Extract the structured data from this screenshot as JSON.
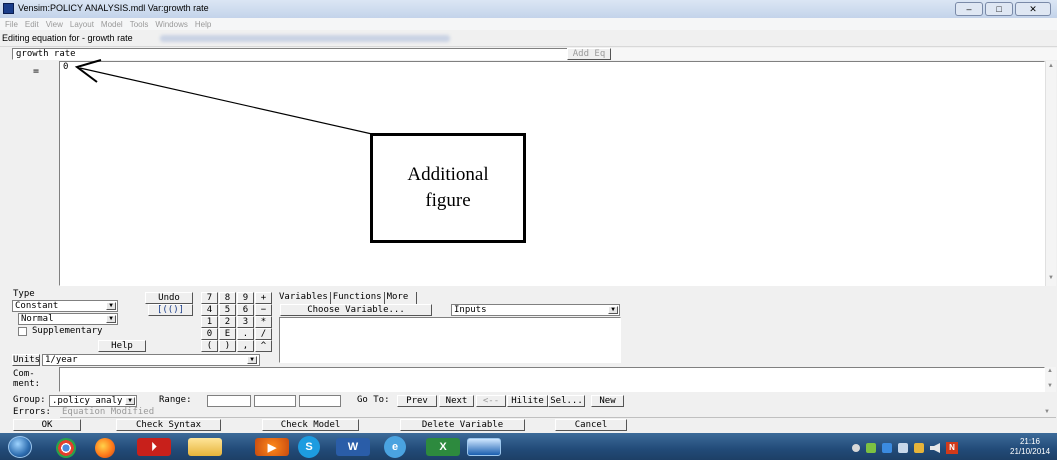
{
  "window": {
    "title": "Vensim:POLICY ANALYSIS.mdl Var:growth rate",
    "controls": {
      "minimize": "–",
      "maximize": "□",
      "close": "✕"
    }
  },
  "menu": [
    "File",
    "Edit",
    "View",
    "Layout",
    "Model",
    "Tools",
    "Windows",
    "Help"
  ],
  "editor": {
    "label": "Editing equation for - growth rate",
    "variable_name": "growth rate",
    "add_eq_label": "Add Eq",
    "eq_sign": "=",
    "equation": "0"
  },
  "annotation": {
    "line1": "Additional",
    "line2": "figure"
  },
  "type_panel": {
    "type_label": "Type",
    "type_value": "Constant",
    "subtype_value": "Normal",
    "supplementary_label": "Supplementary",
    "undo_label": "Undo",
    "paren_label": "[(()]",
    "help_label": "Help",
    "units_label": "Units",
    "units_value": "1/year"
  },
  "keypad": [
    [
      "7",
      "8",
      "9",
      "+"
    ],
    [
      "4",
      "5",
      "6",
      "−"
    ],
    [
      "1",
      "2",
      "3",
      "*"
    ],
    [
      "0",
      "E",
      ".",
      "/"
    ],
    [
      "(",
      ")",
      ",",
      "^"
    ]
  ],
  "var_panel": {
    "tabs": [
      "Variables",
      "Functions",
      "More"
    ],
    "choose_label": "Choose Variable...",
    "inputs_value": "Inputs"
  },
  "comment_label": "Com-\nment:",
  "group": {
    "label": "Group:",
    "value": ".policy analy",
    "range_label": "Range:",
    "goto_label": "Go To:",
    "buttons": [
      "Prev",
      "Next",
      "<--",
      "Hilite",
      "Sel...",
      "New"
    ]
  },
  "errors": {
    "label": "Errors:",
    "value": "Equation Modified"
  },
  "bottom_buttons": [
    "OK",
    "Check Syntax",
    "Check Model",
    "Delete Variable",
    "Cancel"
  ],
  "taskbar": {
    "time": "21:16",
    "date": "21/10/2014"
  }
}
